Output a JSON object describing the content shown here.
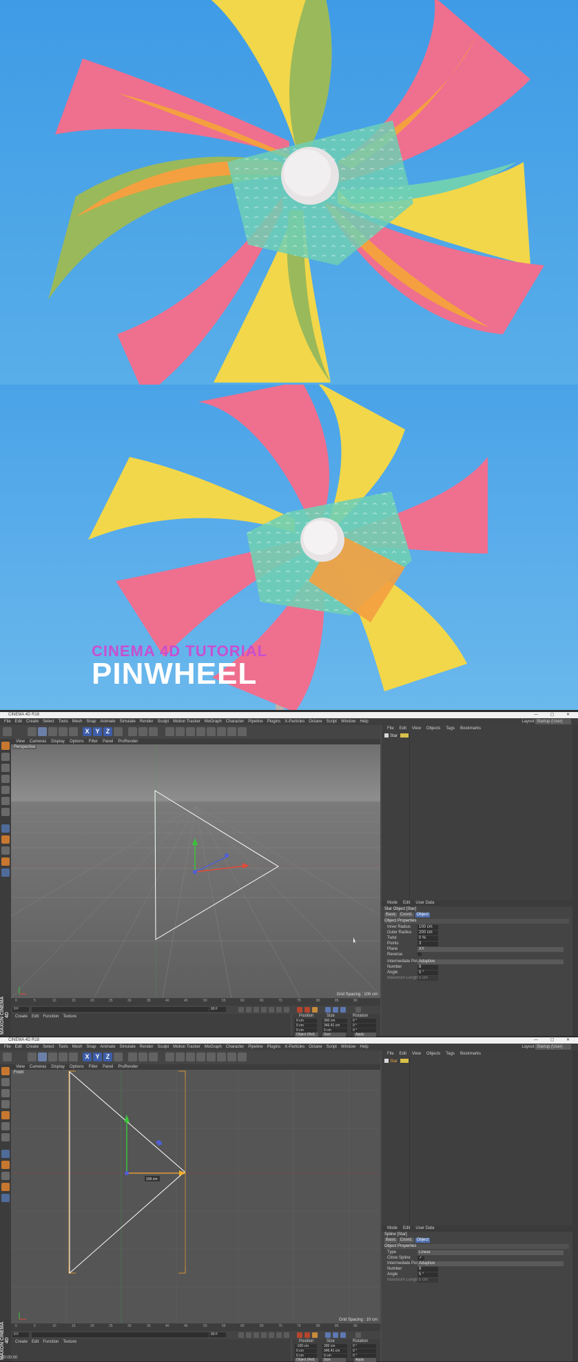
{
  "hero": {
    "subtitle": "CINEMA 4D TUTORIAL",
    "title": "PINWHEEL"
  },
  "colors": {
    "sky": "#3f9be6",
    "pink": "#ef6f8f",
    "orange": "#f4a040",
    "teal": "#6fcfb4",
    "yellow": "#f2d74a",
    "green": "#9ab95a",
    "accent_purple": "#c84fd0",
    "c4d_select_blue": "#4e6fae"
  },
  "app": {
    "window_title": "CINEMA 4D R18",
    "menus": [
      "File",
      "Edit",
      "Create",
      "Select",
      "Tools",
      "Mesh",
      "Snap",
      "Animate",
      "Simulate",
      "Render",
      "Sculpt",
      "Motion Tracker",
      "MoGraph",
      "Character",
      "Pipeline",
      "Plugins",
      "X-Particles",
      "Octane",
      "Script",
      "Window",
      "Help"
    ],
    "layout_label": "Layout:",
    "layout_value": "Startup (User)",
    "viewport_menu": [
      "View",
      "Cameras",
      "Display",
      "Options",
      "Filter",
      "Panel",
      "ProRender"
    ],
    "object_menu": [
      "File",
      "Edit",
      "View",
      "Objects",
      "Tags",
      "Bookmarks"
    ],
    "attr_menu": [
      "Mode",
      "Edit",
      "User Data"
    ],
    "material_menu": [
      "Create",
      "Edit",
      "Function",
      "Texture"
    ],
    "attr_tabs": [
      "Basic",
      "Coord.",
      "Object"
    ],
    "attr_section": "Object Properties",
    "timeline_ticks": [
      "0",
      "5",
      "10",
      "15",
      "20",
      "25",
      "30",
      "35",
      "40",
      "45",
      "50",
      "55",
      "60",
      "65",
      "70",
      "75",
      "80",
      "85",
      "90"
    ],
    "frame_start": "0 F",
    "frame_end": "90 F",
    "coords_headers": [
      "Position",
      "Size",
      "Rotation"
    ],
    "world_label": "Object (Rel)",
    "size_label": "Size",
    "apply_label": "Apply",
    "logo": "MAXON CINEMA 4D",
    "status_text": "00:00:00"
  },
  "screen1": {
    "viewport_label": "Perspective",
    "grid_spacing": "Grid Spacing : 100 cm",
    "object_name": "Star",
    "attr_title": "Star Object [Star]",
    "attributes": [
      {
        "label": "Inner Radius",
        "value": "100 cm"
      },
      {
        "label": "Outer Radius",
        "value": "200 cm"
      },
      {
        "label": "Twist",
        "value": "0 %"
      },
      {
        "label": "Points",
        "value": "3"
      },
      {
        "label": "Plane",
        "value": "XY"
      },
      {
        "label": "Reverse",
        "value": ""
      },
      {
        "label": "Intermediate Points",
        "value": "Adaptive"
      },
      {
        "label": "Number",
        "value": "8"
      },
      {
        "label": "Angle",
        "value": "5 °"
      },
      {
        "label": "Maximum Length",
        "value": "5 cm"
      }
    ],
    "coords": {
      "x": [
        "0 cm",
        "300 cm",
        "0 °"
      ],
      "y": [
        "0 cm",
        "346.41 cm",
        "0 °"
      ],
      "z": [
        "0 cm",
        "0 cm",
        "0 °"
      ]
    }
  },
  "screen2": {
    "viewport_label": "Front",
    "grid_spacing": "Grid Spacing : 10 cm",
    "object_name": "Star",
    "measure": "100 cm",
    "attr_title": "Spline [Star]",
    "attributes": [
      {
        "label": "Type",
        "value": "Linear"
      },
      {
        "label": "Close Spline",
        "value": "✓"
      },
      {
        "label": "Intermediate Points",
        "value": "Adaptive"
      },
      {
        "label": "Number",
        "value": "8"
      },
      {
        "label": "Angle",
        "value": "5 °"
      },
      {
        "label": "Maximum Length",
        "value": "5 cm"
      }
    ],
    "coords": {
      "x": [
        "-100 cm",
        "300 cm",
        "0 °"
      ],
      "y": [
        "0 cm",
        "346.41 cm",
        "0 °"
      ],
      "z": [
        "0 cm",
        "0 cm",
        "0 °"
      ]
    }
  }
}
